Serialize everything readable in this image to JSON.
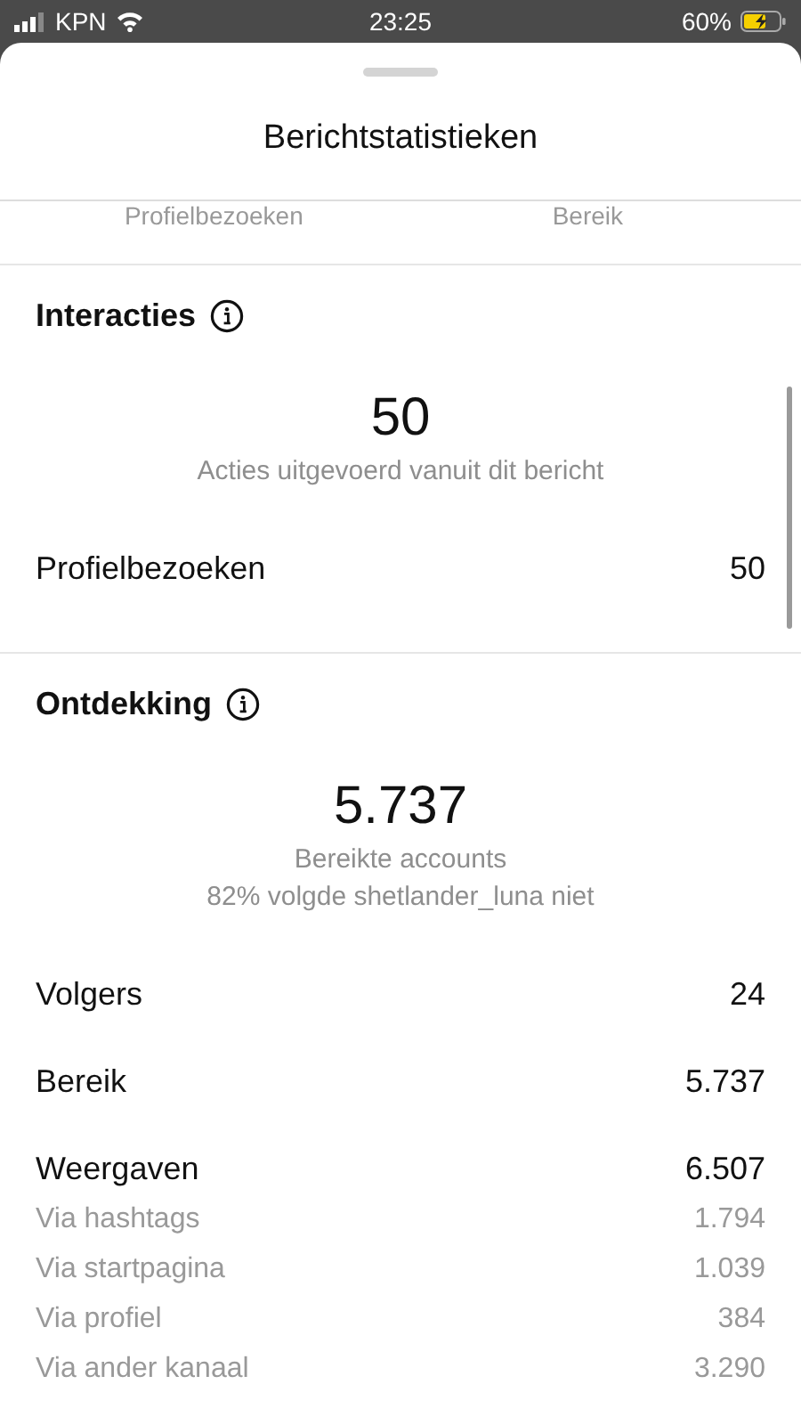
{
  "status_bar": {
    "carrier": "KPN",
    "time": "23:25",
    "battery": "60%"
  },
  "title": "Berichtstatistieken",
  "cut_row": [
    "Profielbezoeken",
    "Bereik"
  ],
  "sections": [
    {
      "heading": "Interacties",
      "big_number": "50",
      "captions": [
        "Acties uitgevoerd vanuit dit bericht"
      ],
      "rows": [
        {
          "kind": "main",
          "label": "Profielbezoeken",
          "value": "50"
        }
      ]
    },
    {
      "heading": "Ontdekking",
      "big_number": "5.737",
      "captions": [
        "Bereikte accounts",
        "82% volgde shetlander_luna niet"
      ],
      "rows": [
        {
          "kind": "main",
          "label": "Volgers",
          "value": "24"
        },
        {
          "kind": "main",
          "label": "Bereik",
          "value": "5.737"
        },
        {
          "kind": "group",
          "label": "Weergaven",
          "value": "6.507"
        },
        {
          "kind": "sub",
          "label": "Via hashtags",
          "value": "1.794"
        },
        {
          "kind": "sub",
          "label": "Via startpagina",
          "value": "1.039"
        },
        {
          "kind": "sub",
          "label": "Via profiel",
          "value": "384"
        },
        {
          "kind": "sub",
          "label": "Via ander kanaal",
          "value": "3.290"
        }
      ]
    }
  ]
}
